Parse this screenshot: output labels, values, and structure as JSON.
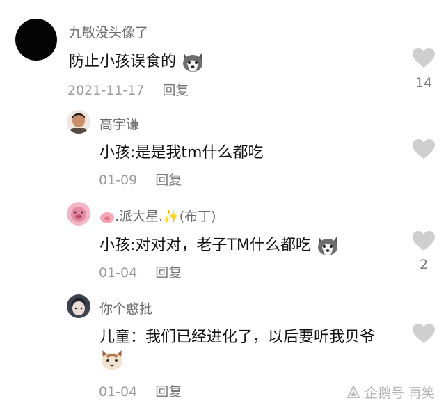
{
  "comments": [
    {
      "username": "九敏没头像了",
      "text": "防止小孩误食的",
      "date": "2021-11-17",
      "reply_label": "回复",
      "like_count": "14",
      "emoji": "husky-dog-emoji"
    },
    {
      "username": "高宇谦",
      "text": "小孩:是是我tm什么都吃",
      "date": "01-09",
      "reply_label": "回复",
      "like_count": ""
    },
    {
      "username": ".派大星.✨(布丁)",
      "text": "小孩:对对对，老子TM什么都吃",
      "date": "01-04",
      "reply_label": "回复",
      "like_count": "2",
      "emoji": "husky-dog-emoji"
    },
    {
      "username": "你个憨批",
      "text": "儿童：我们已经进化了，以后要听我贝爷",
      "date": "01-04",
      "reply_label": "回复",
      "like_count": "",
      "emoji": "cat-emoji"
    }
  ],
  "watermark": {
    "text": "企鹅号 再笑"
  },
  "colors": {
    "heart": "#cfcfcf",
    "username": "#6c6c6c",
    "meta": "#9a9a9a"
  }
}
